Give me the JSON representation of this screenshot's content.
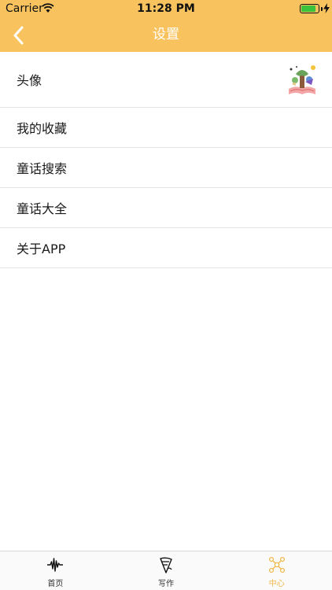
{
  "status_bar": {
    "carrier": "Carrier",
    "time": "11:28 PM",
    "battery_level": 0.9
  },
  "nav": {
    "title": "设置",
    "back_icon": "chevron-left-icon"
  },
  "settings": {
    "rows": [
      {
        "label": "头像",
        "avatar_icon": "avatar-image"
      },
      {
        "label": "我的收藏"
      },
      {
        "label": "童话搜索"
      },
      {
        "label": "童话大全"
      },
      {
        "label": "关于APP"
      }
    ]
  },
  "tab_bar": {
    "tabs": [
      {
        "label": "首页",
        "icon": "waveform-icon"
      },
      {
        "label": "写作",
        "icon": "writing-icon"
      },
      {
        "label": "中心",
        "icon": "network-icon"
      }
    ],
    "active_index": 2
  },
  "colors": {
    "header": "#F8C35E",
    "active_tab": "#F0B84A",
    "divider": "#E4E4E4"
  }
}
